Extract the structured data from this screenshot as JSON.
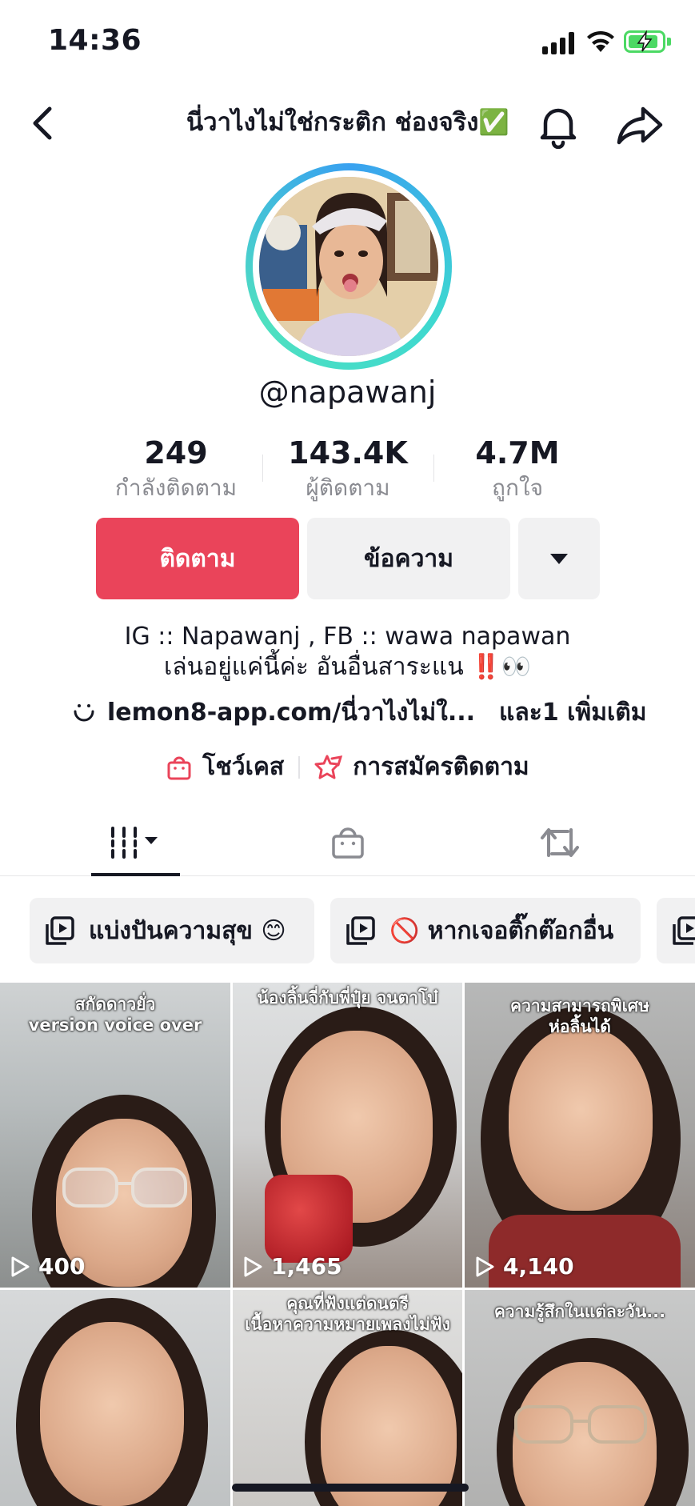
{
  "status_bar": {
    "time": "14:36"
  },
  "header": {
    "title": "นี่วาไงไม่ใช่กระติก ช่องจริง✅"
  },
  "profile": {
    "username": "@napawanj",
    "stats": [
      {
        "value": "249",
        "label": "กำลังติดตาม"
      },
      {
        "value": "143.4K",
        "label": "ผู้ติดตาม"
      },
      {
        "value": "4.7M",
        "label": "ถูกใจ"
      }
    ]
  },
  "actions": {
    "follow_label": "ติดตาม",
    "message_label": "ข้อความ"
  },
  "bio": {
    "line1": "IG :: Napawanj , FB :: wawa napawan",
    "line2": "เล่นอยู่แค่นี้ค่ะ อันอื่นสาระแน ‼️👀",
    "link": "lemon8-app.com/นี่วาไงไม่ใ...",
    "more": "และ1 เพิ่มเติม"
  },
  "features": {
    "showcase": "โชว์เคส",
    "subscription": "การสมัครติดตาม"
  },
  "playlists": [
    {
      "label": "แบ่งปันความสุข 😊"
    },
    {
      "label": "🚫 หากเจอติ๊กต๊อกอื่น"
    }
  ],
  "videos": [
    {
      "caption": "สกัดดาวยั่ว\nversion voice over",
      "views": "400"
    },
    {
      "caption": "น้องลิ้นจี่กับพี่ปุ๋ย จนตาโบ๋",
      "views": "1,465"
    },
    {
      "caption": "ความสามารถพิเศษ\nห่อลิ้นได้",
      "views": "4,140"
    },
    {
      "caption": "",
      "views": ""
    },
    {
      "caption": "คุณที่ฟังแต่ดนตรี\nเนื้อหาความหมายเพลงไม่ฟัง",
      "views": ""
    },
    {
      "caption": "ความรู้สึกในแต่ละวัน...",
      "views": ""
    }
  ],
  "colors": {
    "follow_red": "#ea445a",
    "battery_green": "#4cd964",
    "ring_blue": "#39a1f0",
    "ring_teal": "#3ed8d0"
  }
}
